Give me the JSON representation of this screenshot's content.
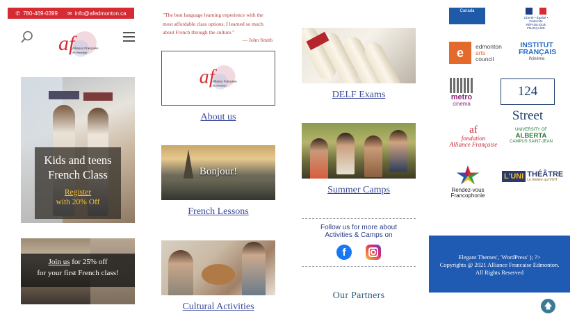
{
  "header": {
    "phone": "780-469-0399",
    "email": "info@afedmonton.ca",
    "phone_icon": "phone-icon",
    "email_icon": "envelope-icon",
    "accent_color": "#d52b33"
  },
  "nav": {
    "search_icon": "search-icon",
    "menu_icon": "hamburger-menu-icon",
    "logo_mark": "af",
    "logo_name": "Alliance Française",
    "logo_city": "d'Edmonton"
  },
  "promo_kids": {
    "title_line1": "Kids and teens",
    "title_line2": "French Class",
    "link": "Register",
    "offer": "with 20% Off"
  },
  "promo_street": {
    "link": "Join us",
    "line1_rest": " for 25% off",
    "line2": "for your first French class!"
  },
  "testimonial": {
    "quote": "\"The best language learning experience with the most affordable class options. I learned so much about French through the culture.\"",
    "author": "— John Smith"
  },
  "cards": {
    "about": "About us",
    "bonjour": "Bonjour!",
    "lessons": "French Lessons",
    "cultural": "Cultural Activities",
    "delf": "DELF Exams",
    "camps": "Summer Camps"
  },
  "social": {
    "follow_line1": "Follow us for more about",
    "follow_line2": "Activities & Camps on",
    "facebook_glyph": "f",
    "facebook_color": "#1877f2",
    "instagram_icon": "instagram-icon"
  },
  "partners": {
    "title": "Our Partners",
    "canada": "Canada",
    "rf_line1": "Liberté • Égalité • Fraternité",
    "rf_line2": "RÉPUBLIQUE FRANÇAISE",
    "eac_mark": "e",
    "eac_word1": "edmonton",
    "eac_word2": "arts",
    "eac_word3": "council",
    "ifc_line1": "INSTITUT",
    "ifc_line2": "FRANÇAIS",
    "ifc_line3": "ifcinéma",
    "metro_line1": "metro",
    "metro_line2": "cinema",
    "street": "124 Street",
    "fondation_mark": "af",
    "fondation_line1": "fondation",
    "fondation_line2": "Alliance Française",
    "ualberta_line1": "UNIVERSITY OF",
    "ualberta_line2": "ALBERTA",
    "ualberta_line3": "CAMPUS SAINT-JEAN",
    "rdv_line1": "Rendez-vous",
    "rdv_line2": "Francophonie",
    "uni_box": "L'UNI",
    "uni_word": "THÉÂTRE",
    "uni_small": "Le théâtre qui VOIT"
  },
  "footer": {
    "line1": "Elegant Themes', 'WordPress' ); ?>",
    "line2": "Copyrights @ 2021 Alliance Francaise Edmonton.",
    "line3": "All Rights Reserved",
    "bg_color": "#1f5ab3"
  },
  "back_to_top_icon": "arrow-up-circle-icon"
}
